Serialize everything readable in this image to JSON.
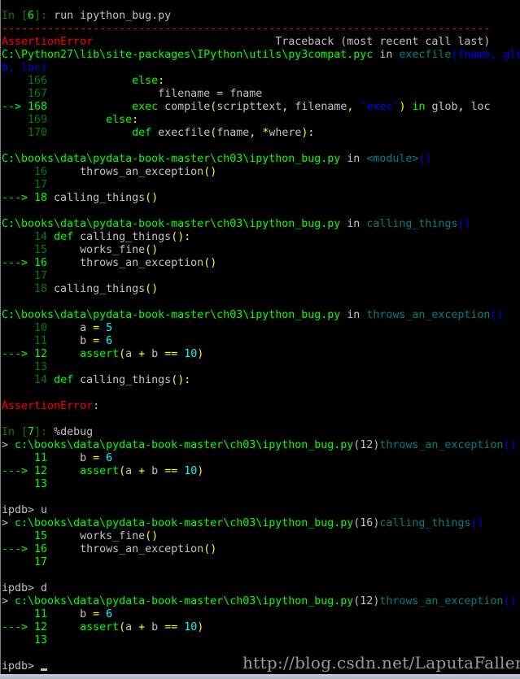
{
  "colors": {
    "g": "#c0c0c0",
    "G": "#00ff00",
    "dg": "#008000",
    "y": "#ffff00",
    "r": "#ff0000",
    "t": "#008080",
    "b": "#0000ff",
    "c": "#00ffff"
  },
  "watermark": "http://blog.csdn.net/LaputaFallen",
  "lines": [
    [
      {
        "t": "In [",
        "c": "dg"
      },
      {
        "t": "6",
        "c": "G"
      },
      {
        "t": "]: ",
        "c": "dg"
      },
      {
        "t": "run ipython_bug.py",
        "c": "g"
      }
    ],
    [
      {
        "t": "---------------------------------------------------------------------------",
        "c": "r"
      }
    ],
    [
      {
        "t": "AssertionError",
        "c": "r"
      },
      {
        "t": "                            Traceback (most recent call last)",
        "c": "g"
      }
    ],
    [
      {
        "t": "C:\\Python27\\lib\\site-packages\\IPython\\utils\\py3compat.pyc",
        "c": "G"
      },
      {
        "t": " in ",
        "c": "g"
      },
      {
        "t": "execfile",
        "c": "t"
      },
      {
        "t": "(fname, glo",
        "c": "b"
      }
    ],
    [
      {
        "t": "b, loc)",
        "c": "b"
      }
    ],
    [
      {
        "t": "    166",
        "c": "dg"
      },
      {
        "t": "             ",
        "c": "g"
      },
      {
        "t": "else",
        "c": "G"
      },
      {
        "t": ":",
        "c": "y"
      }
    ],
    [
      {
        "t": "    167",
        "c": "dg"
      },
      {
        "t": "                 filename = fname",
        "c": "g"
      }
    ],
    [
      {
        "t": "--> 168",
        "c": "G"
      },
      {
        "t": "             ",
        "c": "g"
      },
      {
        "t": "exec",
        "c": "G"
      },
      {
        "t": " compile",
        "c": "g"
      },
      {
        "t": "(",
        "c": "y"
      },
      {
        "t": "scripttext",
        "c": "g"
      },
      {
        "t": ",",
        "c": "y"
      },
      {
        "t": " filename",
        "c": "g"
      },
      {
        "t": ",",
        "c": "y"
      },
      {
        "t": " ",
        "c": "g"
      },
      {
        "t": "'exec'",
        "c": "b"
      },
      {
        "t": ")",
        "c": "y"
      },
      {
        "t": " ",
        "c": "g"
      },
      {
        "t": "in",
        "c": "G"
      },
      {
        "t": " glob",
        "c": "g"
      },
      {
        "t": ",",
        "c": "y"
      },
      {
        "t": " loc",
        "c": "g"
      }
    ],
    [
      {
        "t": "    169",
        "c": "dg"
      },
      {
        "t": "         ",
        "c": "g"
      },
      {
        "t": "else",
        "c": "G"
      },
      {
        "t": ":",
        "c": "y"
      }
    ],
    [
      {
        "t": "    170",
        "c": "dg"
      },
      {
        "t": "             ",
        "c": "g"
      },
      {
        "t": "def",
        "c": "G"
      },
      {
        "t": " execfile",
        "c": "g"
      },
      {
        "t": "(",
        "c": "y"
      },
      {
        "t": "fname",
        "c": "g"
      },
      {
        "t": ",",
        "c": "y"
      },
      {
        "t": " ",
        "c": "g"
      },
      {
        "t": "*",
        "c": "y"
      },
      {
        "t": "where",
        "c": "g"
      },
      {
        "t": "):",
        "c": "y"
      }
    ],
    [],
    [
      {
        "t": "C:\\books\\data\\pydata-book-master\\ch03\\ipython_bug.py",
        "c": "G"
      },
      {
        "t": " in ",
        "c": "g"
      },
      {
        "t": "<module>",
        "c": "t"
      },
      {
        "t": "()",
        "c": "b"
      }
    ],
    [
      {
        "t": "     16",
        "c": "dg"
      },
      {
        "t": "     throws_an_exception",
        "c": "g"
      },
      {
        "t": "()",
        "c": "y"
      }
    ],
    [
      {
        "t": "     17",
        "c": "dg"
      }
    ],
    [
      {
        "t": "---> 18",
        "c": "G"
      },
      {
        "t": " calling_things",
        "c": "g"
      },
      {
        "t": "()",
        "c": "y"
      }
    ],
    [],
    [
      {
        "t": "C:\\books\\data\\pydata-book-master\\ch03\\ipython_bug.py",
        "c": "G"
      },
      {
        "t": " in ",
        "c": "g"
      },
      {
        "t": "calling_things",
        "c": "t"
      },
      {
        "t": "()",
        "c": "b"
      }
    ],
    [
      {
        "t": "     14",
        "c": "dg"
      },
      {
        "t": " ",
        "c": "g"
      },
      {
        "t": "def",
        "c": "G"
      },
      {
        "t": " calling_things",
        "c": "g"
      },
      {
        "t": "():",
        "c": "y"
      }
    ],
    [
      {
        "t": "     15",
        "c": "dg"
      },
      {
        "t": "     works_fine",
        "c": "g"
      },
      {
        "t": "()",
        "c": "y"
      }
    ],
    [
      {
        "t": "---> 16",
        "c": "G"
      },
      {
        "t": "     throws_an_exception",
        "c": "g"
      },
      {
        "t": "()",
        "c": "y"
      }
    ],
    [
      {
        "t": "     17",
        "c": "dg"
      }
    ],
    [
      {
        "t": "     18",
        "c": "dg"
      },
      {
        "t": " calling_things",
        "c": "g"
      },
      {
        "t": "()",
        "c": "y"
      }
    ],
    [],
    [
      {
        "t": "C:\\books\\data\\pydata-book-master\\ch03\\ipython_bug.py",
        "c": "G"
      },
      {
        "t": " in ",
        "c": "g"
      },
      {
        "t": "throws_an_exception",
        "c": "t"
      },
      {
        "t": "()",
        "c": "b"
      }
    ],
    [
      {
        "t": "     10",
        "c": "dg"
      },
      {
        "t": "     a ",
        "c": "g"
      },
      {
        "t": "=",
        "c": "y"
      },
      {
        "t": " ",
        "c": "g"
      },
      {
        "t": "5",
        "c": "c"
      }
    ],
    [
      {
        "t": "     11",
        "c": "dg"
      },
      {
        "t": "     b ",
        "c": "g"
      },
      {
        "t": "=",
        "c": "y"
      },
      {
        "t": " ",
        "c": "g"
      },
      {
        "t": "6",
        "c": "c"
      }
    ],
    [
      {
        "t": "---> 12",
        "c": "G"
      },
      {
        "t": "     ",
        "c": "g"
      },
      {
        "t": "assert",
        "c": "G"
      },
      {
        "t": "(",
        "c": "y"
      },
      {
        "t": "a ",
        "c": "g"
      },
      {
        "t": "+",
        "c": "y"
      },
      {
        "t": " b ",
        "c": "g"
      },
      {
        "t": "==",
        "c": "y"
      },
      {
        "t": " ",
        "c": "g"
      },
      {
        "t": "10",
        "c": "c"
      },
      {
        "t": ")",
        "c": "y"
      }
    ],
    [
      {
        "t": "     13",
        "c": "dg"
      }
    ],
    [
      {
        "t": "     14",
        "c": "dg"
      },
      {
        "t": " ",
        "c": "g"
      },
      {
        "t": "def",
        "c": "G"
      },
      {
        "t": " calling_things",
        "c": "g"
      },
      {
        "t": "():",
        "c": "y"
      }
    ],
    [],
    [
      {
        "t": "AssertionError",
        "c": "r"
      },
      {
        "t": ":",
        "c": "g"
      }
    ],
    [],
    [
      {
        "t": "In [",
        "c": "dg"
      },
      {
        "t": "7",
        "c": "G"
      },
      {
        "t": "]: ",
        "c": "dg"
      },
      {
        "t": "%debug",
        "c": "g"
      }
    ],
    [
      {
        "t": "> ",
        "c": "g"
      },
      {
        "t": "c:\\books\\data\\pydata-book-master\\ch03\\ipython_bug.py",
        "c": "G"
      },
      {
        "t": "(12)",
        "c": "g"
      },
      {
        "t": "throws_an_exception",
        "c": "t"
      },
      {
        "t": "()",
        "c": "b"
      }
    ],
    [
      {
        "t": "     11",
        "c": "G"
      },
      {
        "t": "     b ",
        "c": "g"
      },
      {
        "t": "=",
        "c": "y"
      },
      {
        "t": " ",
        "c": "g"
      },
      {
        "t": "6",
        "c": "c"
      }
    ],
    [
      {
        "t": "---> 12",
        "c": "G"
      },
      {
        "t": "     ",
        "c": "g"
      },
      {
        "t": "assert",
        "c": "G"
      },
      {
        "t": "(",
        "c": "y"
      },
      {
        "t": "a ",
        "c": "g"
      },
      {
        "t": "+",
        "c": "y"
      },
      {
        "t": " b ",
        "c": "g"
      },
      {
        "t": "==",
        "c": "y"
      },
      {
        "t": " ",
        "c": "g"
      },
      {
        "t": "10",
        "c": "c"
      },
      {
        "t": ")",
        "c": "y"
      }
    ],
    [
      {
        "t": "     13",
        "c": "G"
      }
    ],
    [],
    [
      {
        "t": "ipdb> u",
        "c": "g"
      }
    ],
    [
      {
        "t": "> ",
        "c": "g"
      },
      {
        "t": "c:\\books\\data\\pydata-book-master\\ch03\\ipython_bug.py",
        "c": "G"
      },
      {
        "t": "(16)",
        "c": "g"
      },
      {
        "t": "calling_things",
        "c": "t"
      },
      {
        "t": "()",
        "c": "b"
      }
    ],
    [
      {
        "t": "     15",
        "c": "G"
      },
      {
        "t": "     works_fine",
        "c": "g"
      },
      {
        "t": "()",
        "c": "y"
      }
    ],
    [
      {
        "t": "---> 16",
        "c": "G"
      },
      {
        "t": "     throws_an_exception",
        "c": "g"
      },
      {
        "t": "()",
        "c": "y"
      }
    ],
    [
      {
        "t": "     17",
        "c": "G"
      }
    ],
    [],
    [
      {
        "t": "ipdb> d",
        "c": "g"
      }
    ],
    [
      {
        "t": "> ",
        "c": "g"
      },
      {
        "t": "c:\\books\\data\\pydata-book-master\\ch03\\ipython_bug.py",
        "c": "G"
      },
      {
        "t": "(12)",
        "c": "g"
      },
      {
        "t": "throws_an_exception",
        "c": "t"
      },
      {
        "t": "()",
        "c": "b"
      }
    ],
    [
      {
        "t": "     11",
        "c": "G"
      },
      {
        "t": "     b ",
        "c": "g"
      },
      {
        "t": "=",
        "c": "y"
      },
      {
        "t": " ",
        "c": "g"
      },
      {
        "t": "6",
        "c": "c"
      }
    ],
    [
      {
        "t": "---> 12",
        "c": "G"
      },
      {
        "t": "     ",
        "c": "g"
      },
      {
        "t": "assert",
        "c": "G"
      },
      {
        "t": "(",
        "c": "y"
      },
      {
        "t": "a ",
        "c": "g"
      },
      {
        "t": "+",
        "c": "y"
      },
      {
        "t": " b ",
        "c": "g"
      },
      {
        "t": "==",
        "c": "y"
      },
      {
        "t": " ",
        "c": "g"
      },
      {
        "t": "10",
        "c": "c"
      },
      {
        "t": ")",
        "c": "y"
      }
    ],
    [
      {
        "t": "     13",
        "c": "G"
      }
    ],
    [],
    [
      {
        "t": "ipdb> ",
        "c": "g"
      }
    ]
  ]
}
